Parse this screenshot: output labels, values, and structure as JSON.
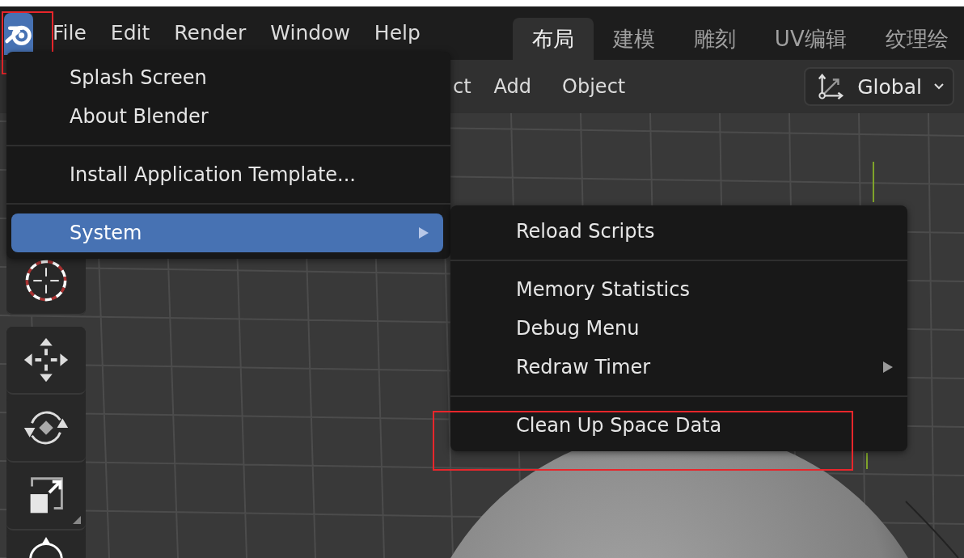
{
  "app_logo": {
    "highlighted": true
  },
  "menubar": [
    "File",
    "Edit",
    "Render",
    "Window",
    "Help"
  ],
  "workspace_tabs": [
    {
      "label": "布局",
      "selected": true
    },
    {
      "label": "建模",
      "selected": false
    },
    {
      "label": "雕刻",
      "selected": false
    },
    {
      "label": "UV编辑",
      "selected": false
    },
    {
      "label": "纹理绘",
      "selected": false
    }
  ],
  "header": {
    "menu": [
      "ct",
      "Add",
      "Object"
    ],
    "orientation": {
      "label": "Global"
    }
  },
  "app_menu": {
    "items": [
      {
        "kind": "item",
        "label": "Splash Screen",
        "selected": false,
        "has_submenu": false,
        "highlighted": false
      },
      {
        "kind": "item",
        "label": "About Blender",
        "selected": false,
        "has_submenu": false,
        "highlighted": false
      },
      {
        "kind": "separator"
      },
      {
        "kind": "item",
        "label": "Install Application Template...",
        "selected": false,
        "has_submenu": false,
        "highlighted": false
      },
      {
        "kind": "separator"
      },
      {
        "kind": "item",
        "label": "System",
        "selected": true,
        "has_submenu": true,
        "highlighted": false
      }
    ]
  },
  "system_submenu": {
    "items": [
      {
        "kind": "item",
        "label": "Reload Scripts",
        "selected": false,
        "has_submenu": false,
        "highlighted": false
      },
      {
        "kind": "separator"
      },
      {
        "kind": "item",
        "label": "Memory Statistics",
        "selected": false,
        "has_submenu": false,
        "highlighted": false
      },
      {
        "kind": "item",
        "label": "Debug Menu",
        "selected": false,
        "has_submenu": false,
        "highlighted": false
      },
      {
        "kind": "item",
        "label": "Redraw Timer",
        "selected": false,
        "has_submenu": true,
        "highlighted": false
      },
      {
        "kind": "separator"
      },
      {
        "kind": "item",
        "label": "Clean Up Space Data",
        "selected": false,
        "has_submenu": false,
        "highlighted": true
      }
    ]
  }
}
